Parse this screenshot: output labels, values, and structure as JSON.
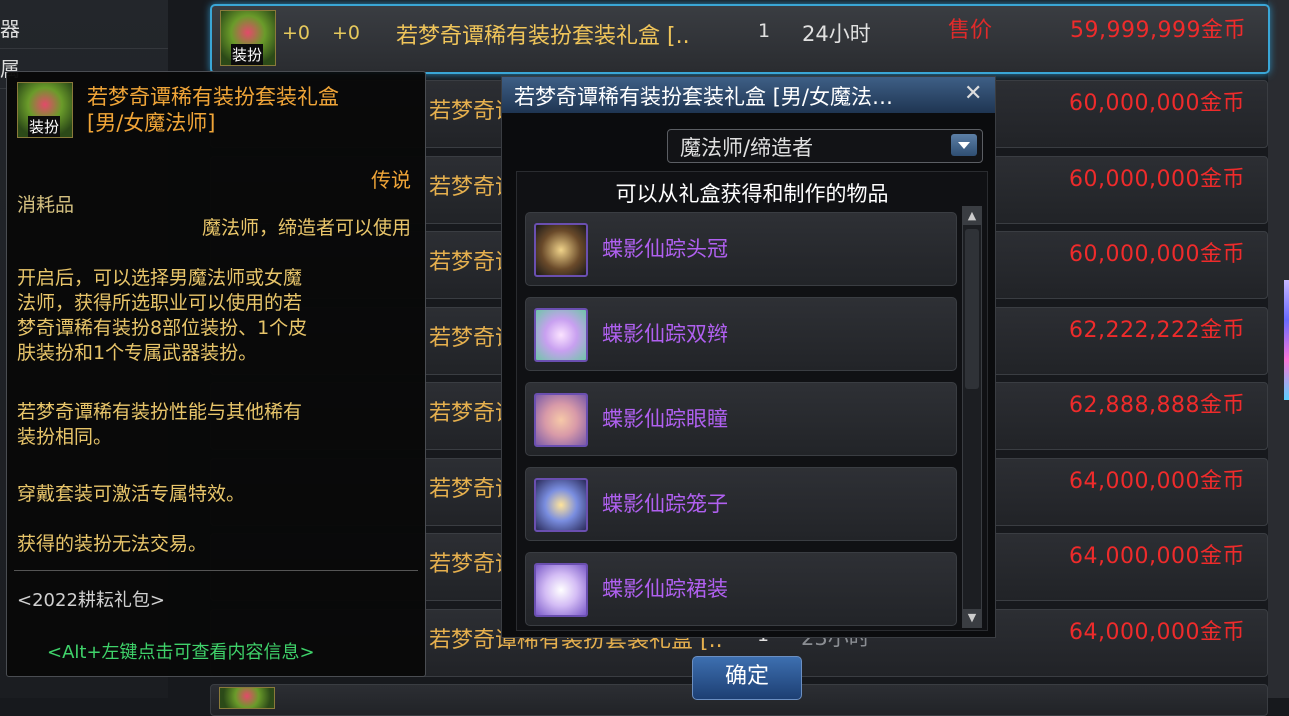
{
  "left_panel": {
    "rows": [
      "器",
      "属"
    ]
  },
  "auction": {
    "selected_row": {
      "icon_tag": "装扮",
      "plus1": "+0",
      "plus2": "+0",
      "name": "若梦奇谭稀有装扮套装礼盒 [..",
      "qty": "1",
      "time": "24小时",
      "price_label": "售价",
      "price": "59,999,999金币"
    },
    "rows": [
      {
        "name_partial": "若梦奇谭稀有装扮套装礼盒 [..",
        "price": "60,000,000金币"
      },
      {
        "name_partial": "若梦奇谭稀",
        "price": "60,000,000金币"
      },
      {
        "name_partial": "若梦奇谭稀",
        "price": "60,000,000金币"
      },
      {
        "name_partial": "若梦奇谭稀",
        "price": "62,222,222金币"
      },
      {
        "name_partial": "若梦奇谭稀",
        "price": "62,888,888金币"
      },
      {
        "name_partial": "若梦奇谭稀",
        "price": "64,000,000金币"
      },
      {
        "name_partial": "若梦奇谭稀",
        "price": "64,000,000金币"
      },
      {
        "name_partial": "若梦奇谭稀有装扮套装礼盒 [..",
        "qty": "1",
        "time": "23小时",
        "price": "64,000,000金币"
      }
    ]
  },
  "tooltip": {
    "icon_tag": "装扮",
    "title_line1": "若梦奇谭稀有装扮套装礼盒",
    "title_line2": "[男/女魔法师]",
    "rarity": "传说",
    "type": "消耗品",
    "usable_by": "魔法师，缔造者可以使用",
    "desc1_lines": [
      "开启后，可以选择男魔法师或女魔",
      "法师，获得所选职业可以使用的若",
      "梦奇谭稀有装扮8部位装扮、1个皮",
      "肤装扮和1个专属武器装扮。"
    ],
    "desc2_lines": [
      "若梦奇谭稀有装扮性能与其他稀有",
      "装扮相同。"
    ],
    "desc3": "穿戴套装可激活专属特效。",
    "desc4": "获得的装扮无法交易。",
    "source": "<2022耕耘礼包>",
    "hint": "<Alt+左键点击可查看内容信息>"
  },
  "popup": {
    "title": "若梦奇谭稀有装扮套装礼盒 [男/女魔法…",
    "close_label": "✕",
    "job_select": "魔法师/缔造者",
    "list_header": "可以从礼盒获得和制作的物品",
    "items": [
      "蝶影仙踪头冠",
      "蝶影仙踪双辫",
      "蝶影仙踪眼瞳",
      "蝶影仙踪笼子",
      "蝶影仙踪裙装"
    ],
    "confirm_label": "确定"
  },
  "colors": {
    "price_red": "#ef2b2b",
    "item_purple": "#b060f0",
    "title_orange": "#f0a538",
    "desc_gold": "#e8c56a",
    "hint_green": "#3fd26a",
    "select_border": "#3aa6d6"
  }
}
